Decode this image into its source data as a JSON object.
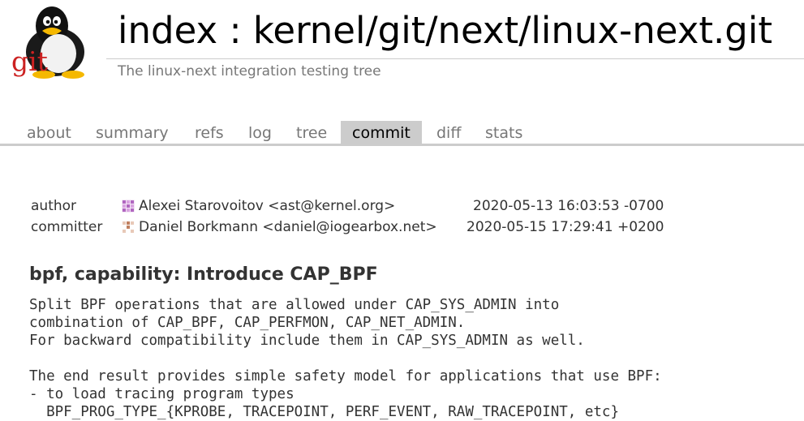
{
  "header": {
    "logo_text": "git",
    "index_link": "index",
    "separator": ":",
    "repo_path": "kernel/git/next/linux-next.git",
    "description": "The linux-next integration testing tree"
  },
  "tabs": [
    {
      "label": "about",
      "active": false
    },
    {
      "label": "summary",
      "active": false
    },
    {
      "label": "refs",
      "active": false
    },
    {
      "label": "log",
      "active": false
    },
    {
      "label": "tree",
      "active": false
    },
    {
      "label": "commit",
      "active": true
    },
    {
      "label": "diff",
      "active": false
    },
    {
      "label": "stats",
      "active": false
    }
  ],
  "commit_info": {
    "author": {
      "label": "author",
      "name": "Alexei Starovoitov <ast@kernel.org>",
      "date": "2020-05-13 16:03:53 -0700",
      "avatar_icon": "identicon-purple"
    },
    "committer": {
      "label": "committer",
      "name": "Daniel Borkmann <daniel@iogearbox.net>",
      "date": "2020-05-15 17:29:41 +0200",
      "avatar_icon": "identicon-brown"
    }
  },
  "subject": "bpf, capability: Introduce CAP_BPF",
  "message_lines": [
    "Split BPF operations that are allowed under CAP_SYS_ADMIN into",
    "combination of CAP_BPF, CAP_PERFMON, CAP_NET_ADMIN.",
    "For backward compatibility include them in CAP_SYS_ADMIN as well.",
    "",
    "The end result provides simple safety model for applications that use BPF:",
    "- to load tracing program types",
    "  BPF_PROG_TYPE_{KPROBE, TRACEPOINT, PERF_EVENT, RAW_TRACEPOINT, etc}"
  ],
  "colors": {
    "tab_active_bg": "#cccccc",
    "muted_text": "#777777",
    "logo_red": "#cc2222"
  }
}
